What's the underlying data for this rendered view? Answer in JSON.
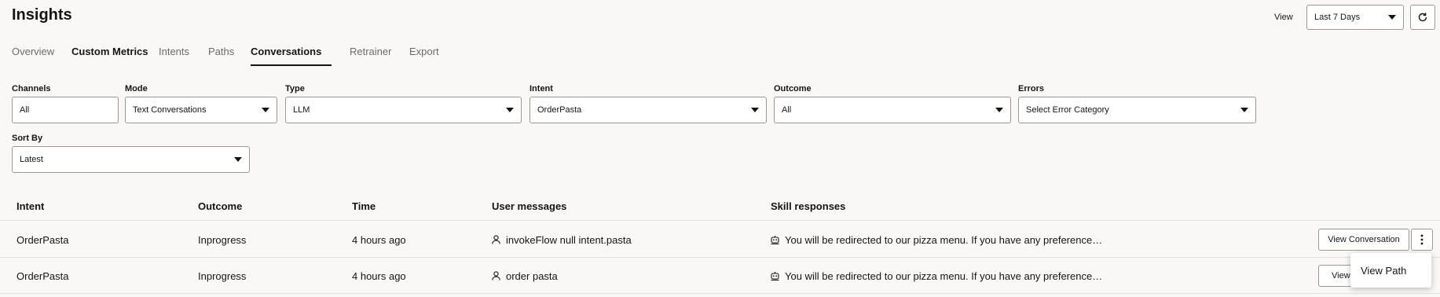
{
  "header": {
    "title": "Insights",
    "view_label": "View",
    "view_value": "Last 7 Days",
    "refresh_icon": "refresh-icon"
  },
  "tabs": [
    {
      "label": "Overview",
      "state": "normal"
    },
    {
      "label": "Custom Metrics",
      "state": "bold"
    },
    {
      "label": "Intents",
      "state": "normal"
    },
    {
      "label": "Paths",
      "state": "normal"
    },
    {
      "label": "Conversations",
      "state": "active"
    },
    {
      "label": "Retrainer",
      "state": "normal"
    },
    {
      "label": "Export",
      "state": "normal"
    }
  ],
  "filters": {
    "channels": {
      "label": "Channels",
      "value": "All"
    },
    "mode": {
      "label": "Mode",
      "value": "Text Conversations"
    },
    "type": {
      "label": "Type",
      "value": "LLM"
    },
    "intent": {
      "label": "Intent",
      "value": "OrderPasta"
    },
    "outcome": {
      "label": "Outcome",
      "value": "All"
    },
    "errors": {
      "label": "Errors",
      "value": "Select Error Category"
    },
    "sort_by": {
      "label": "Sort By",
      "value": "Latest"
    }
  },
  "table": {
    "columns": [
      "Intent",
      "Outcome",
      "Time",
      "User messages",
      "Skill responses"
    ],
    "rows": [
      {
        "intent": "OrderPasta",
        "outcome": "Inprogress",
        "time": "4 hours ago",
        "user_message": "invokeFlow null intent.pasta",
        "skill_response": "You will be redirected to our pizza menu. If you have any preference…",
        "action_label": "View Conversation"
      },
      {
        "intent": "OrderPasta",
        "outcome": "Inprogress",
        "time": "4 hours ago",
        "user_message": "order pasta",
        "skill_response": "You will be redirected to our pizza menu. If you have any preference…",
        "action_label": "View C"
      }
    ]
  },
  "row_menu": {
    "item": "View Path"
  },
  "colors": {
    "background": "#f9f8f6",
    "text": "#161513",
    "muted": "#6f6a64",
    "border": "#9e9892"
  }
}
